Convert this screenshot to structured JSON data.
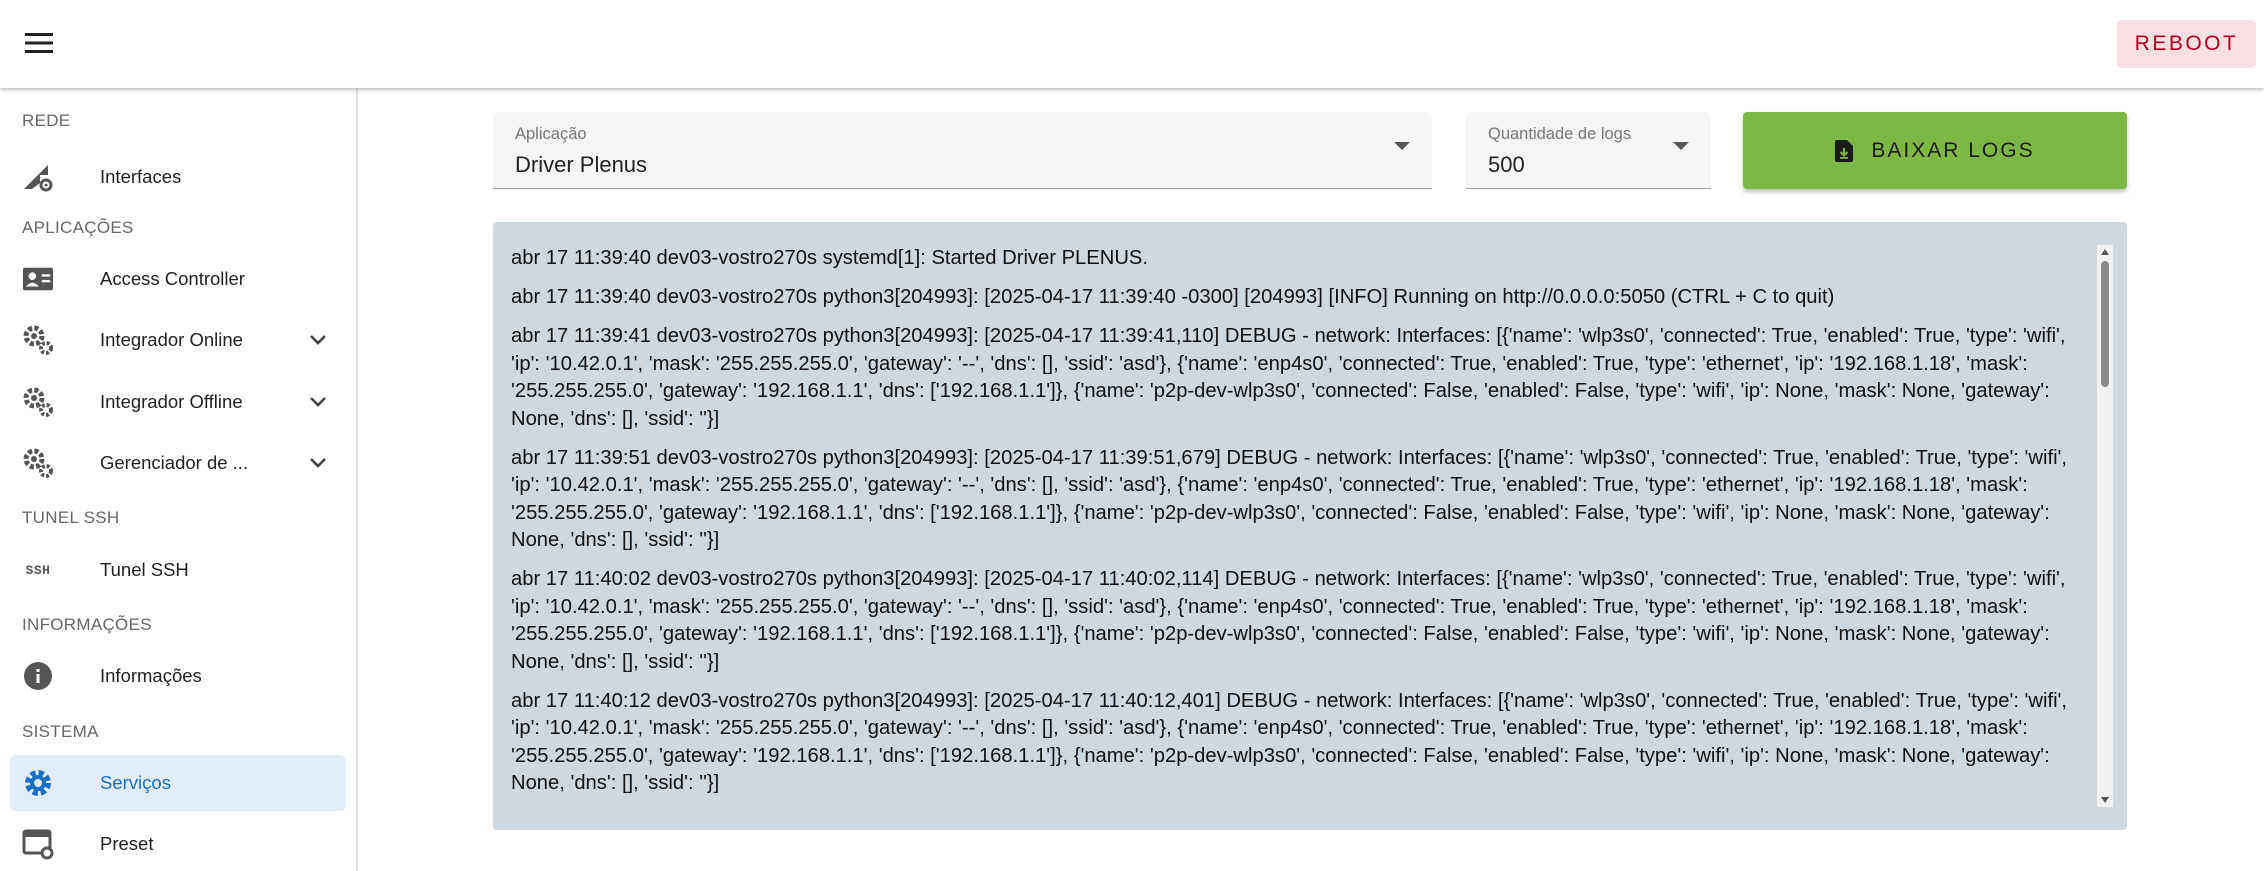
{
  "appbar": {
    "menu_icon": "hamburger-menu-icon",
    "reboot_label": "REBOOT",
    "reboot_color": "#b00020"
  },
  "sidebar": {
    "sections": {
      "rede": "REDE",
      "aplicacoes": "APLICAÇÕES",
      "tunel_ssh": "TUNEL SSH",
      "informacoes": "INFORMAÇÕES",
      "sistema": "SISTEMA"
    },
    "items": [
      {
        "label": "Interfaces",
        "icon": "network-cell-gear-icon"
      },
      {
        "label": "Access Controller",
        "icon": "contact-card-icon"
      },
      {
        "label": "Integrador Online",
        "icon": "gears-icon",
        "expandable": true
      },
      {
        "label": "Integrador Offline",
        "icon": "gears-icon",
        "expandable": true
      },
      {
        "label": "Gerenciador de ...",
        "icon": "gears-icon",
        "expandable": true
      },
      {
        "label": "Tunel SSH",
        "icon": "ssh-icon",
        "icon_text": "SSH"
      },
      {
        "label": "Informações",
        "icon": "info-icon"
      },
      {
        "label": "Serviços",
        "icon": "gear-icon",
        "active": true
      },
      {
        "label": "Preset",
        "icon": "window-gear-icon"
      }
    ],
    "active_color": "#1a6fc4"
  },
  "main": {
    "app_select": {
      "label": "Aplicação",
      "value": "Driver Plenus"
    },
    "count_select": {
      "label": "Quantidade de logs",
      "value": "500"
    },
    "download_label": "BAIXAR LOGS",
    "download_icon": "file-download-icon",
    "download_color": "#7cb944",
    "logs": [
      "abr 17 11:39:40 dev03-vostro270s systemd[1]: Started Driver PLENUS.",
      "abr 17 11:39:40 dev03-vostro270s python3[204993]: [2025-04-17 11:39:40 -0300] [204993] [INFO] Running on http://0.0.0.0:5050 (CTRL + C to quit)",
      "abr 17 11:39:41 dev03-vostro270s python3[204993]: [2025-04-17 11:39:41,110] DEBUG - network: Interfaces: [{'name': 'wlp3s0', 'connected': True, 'enabled': True, 'type': 'wifi', 'ip': '10.42.0.1', 'mask': '255.255.255.0', 'gateway': '--', 'dns': [], 'ssid': 'asd'}, {'name': 'enp4s0', 'connected': True, 'enabled': True, 'type': 'ethernet', 'ip': '192.168.1.18', 'mask': '255.255.255.0', 'gateway': '192.168.1.1', 'dns': ['192.168.1.1']}, {'name': 'p2p-dev-wlp3s0', 'connected': False, 'enabled': False, 'type': 'wifi', 'ip': None, 'mask': None, 'gateway': None, 'dns': [], 'ssid': ''}]",
      "abr 17 11:39:51 dev03-vostro270s python3[204993]: [2025-04-17 11:39:51,679] DEBUG - network: Interfaces: [{'name': 'wlp3s0', 'connected': True, 'enabled': True, 'type': 'wifi', 'ip': '10.42.0.1', 'mask': '255.255.255.0', 'gateway': '--', 'dns': [], 'ssid': 'asd'}, {'name': 'enp4s0', 'connected': True, 'enabled': True, 'type': 'ethernet', 'ip': '192.168.1.18', 'mask': '255.255.255.0', 'gateway': '192.168.1.1', 'dns': ['192.168.1.1']}, {'name': 'p2p-dev-wlp3s0', 'connected': False, 'enabled': False, 'type': 'wifi', 'ip': None, 'mask': None, 'gateway': None, 'dns': [], 'ssid': ''}]",
      "abr 17 11:40:02 dev03-vostro270s python3[204993]: [2025-04-17 11:40:02,114] DEBUG - network: Interfaces: [{'name': 'wlp3s0', 'connected': True, 'enabled': True, 'type': 'wifi', 'ip': '10.42.0.1', 'mask': '255.255.255.0', 'gateway': '--', 'dns': [], 'ssid': 'asd'}, {'name': 'enp4s0', 'connected': True, 'enabled': True, 'type': 'ethernet', 'ip': '192.168.1.18', 'mask': '255.255.255.0', 'gateway': '192.168.1.1', 'dns': ['192.168.1.1']}, {'name': 'p2p-dev-wlp3s0', 'connected': False, 'enabled': False, 'type': 'wifi', 'ip': None, 'mask': None, 'gateway': None, 'dns': [], 'ssid': ''}]",
      "abr 17 11:40:12 dev03-vostro270s python3[204993]: [2025-04-17 11:40:12,401] DEBUG - network: Interfaces: [{'name': 'wlp3s0', 'connected': True, 'enabled': True, 'type': 'wifi', 'ip': '10.42.0.1', 'mask': '255.255.255.0', 'gateway': '--', 'dns': [], 'ssid': 'asd'}, {'name': 'enp4s0', 'connected': True, 'enabled': True, 'type': 'ethernet', 'ip': '192.168.1.18', 'mask': '255.255.255.0', 'gateway': '192.168.1.1', 'dns': ['192.168.1.1']}, {'name': 'p2p-dev-wlp3s0', 'connected': False, 'enabled': False, 'type': 'wifi', 'ip': None, 'mask': None, 'gateway': None, 'dns': [], 'ssid': ''}]"
    ]
  }
}
